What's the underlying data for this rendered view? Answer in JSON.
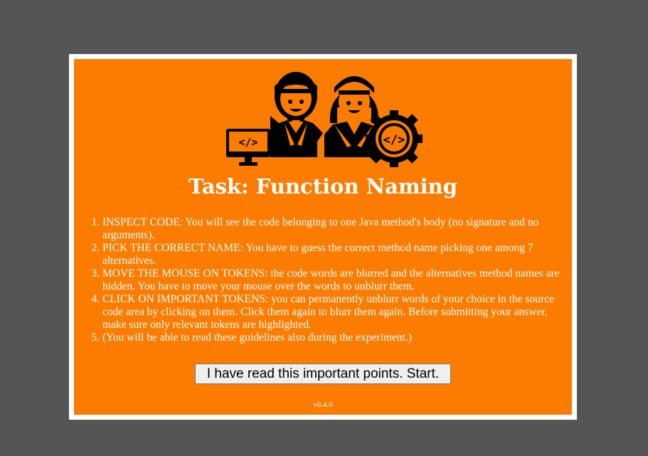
{
  "modal": {
    "illustration_icon": "developers-coding-icon",
    "title": "Task: Function Naming",
    "guidelines": [
      "INSPECT CODE: You will see the code belonging to one Java method's body (no signature and no arguments).",
      "PICK THE CORRECT NAME: You have to guess the correct method name picking one among 7 alternatives.",
      "MOVE THE MOUSE ON TOKENS: the code words are blurred and the alternatives method names are hidden. You have to move your mouse over the words to unblurr them.",
      "CLICK ON IMPORTANT TOKENS: you can permanently unblurr words of your choice in the source code area by clicking on them. Click them again to blurr them again. Before submitting your answer, make sure only relevant tokens are highlighted.",
      "(You will be able to read these guidelines also during the experiment.)"
    ],
    "start_button_label": "I have read this important points. Start.",
    "version": "v0.4.0"
  },
  "colors": {
    "backdrop": "#555555",
    "frame": "#ffffff",
    "panel": "#fb7c00",
    "text": "#ffffff",
    "icon": "#000000"
  }
}
